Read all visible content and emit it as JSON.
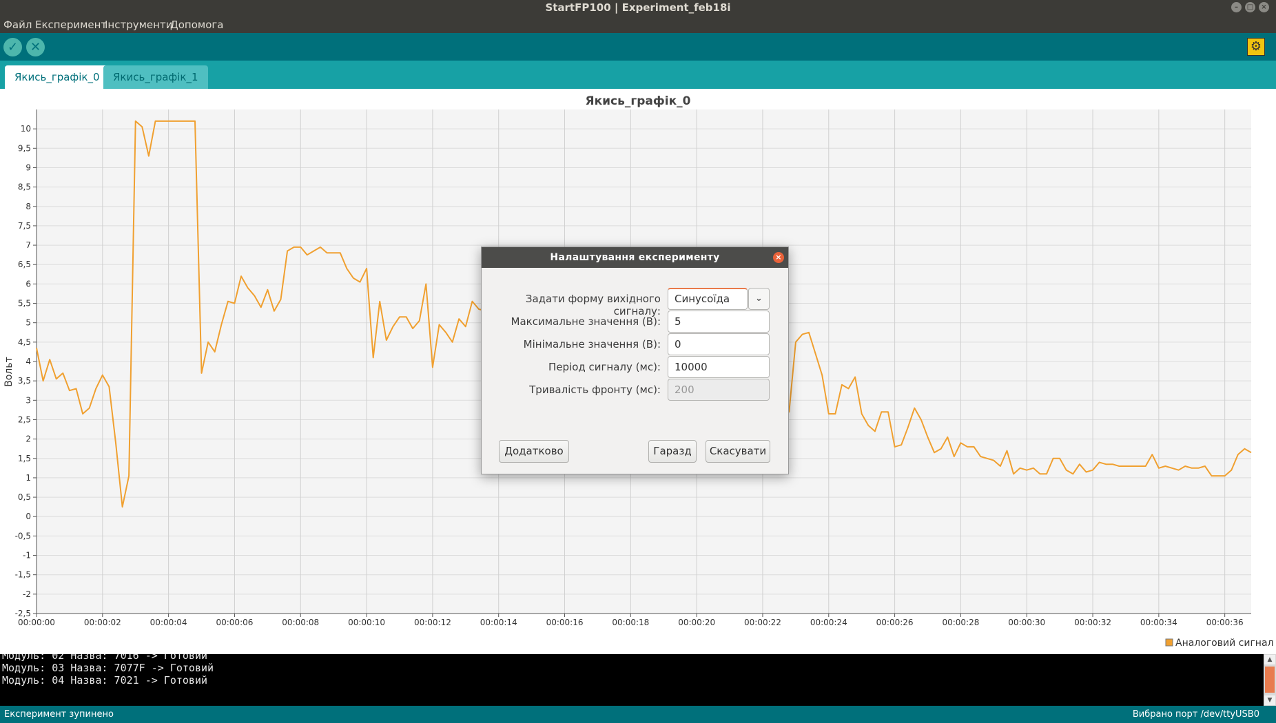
{
  "window": {
    "title": "StartFP100 | Experiment_feb18i"
  },
  "menu": [
    "Файл",
    "Експеримент",
    "Інструменти",
    "Допомога"
  ],
  "toolbar": {
    "verify_icon": "checkmark-icon",
    "stop_icon": "cross-icon",
    "settings_icon": "gear-icon"
  },
  "tabs": [
    {
      "label": "Якись_графік_0",
      "active": true
    },
    {
      "label": "Якись_графік_1",
      "active": false
    }
  ],
  "chart_data": {
    "type": "line",
    "title": "Якись_графік_0",
    "ylabel": "Вольт",
    "xlabel": "",
    "ylim": [
      -2.5,
      10.5
    ],
    "xlim": [
      0,
      36.8
    ],
    "y_ticks": [
      "-2,5",
      "-2",
      "-1,5",
      "-1",
      "-0,5",
      "0",
      "0,5",
      "1",
      "1,5",
      "2",
      "2,5",
      "3",
      "3,5",
      "4",
      "4,5",
      "5",
      "5,5",
      "6",
      "6,5",
      "7",
      "7,5",
      "8",
      "8,5",
      "9",
      "9,5",
      "10"
    ],
    "x_ticks": [
      "00:00:00",
      "00:00:02",
      "00:00:04",
      "00:00:06",
      "00:00:08",
      "00:00:10",
      "00:00:12",
      "00:00:14",
      "00:00:16",
      "00:00:18",
      "00:00:20",
      "00:00:22",
      "00:00:24",
      "00:00:26",
      "00:00:28",
      "00:00:30",
      "00:00:32",
      "00:00:34",
      "00:00:36"
    ],
    "grid": true,
    "legend_position": "bottom-right",
    "series": [
      {
        "name": "Аналоговий сигнал",
        "color": "#f0a030",
        "x": [
          0,
          0.2,
          0.4,
          0.6,
          0.8,
          1.0,
          1.2,
          1.4,
          1.6,
          1.8,
          2.0,
          2.2,
          2.4,
          2.6,
          2.8,
          3.0,
          3.2,
          3.4,
          3.6,
          3.8,
          4.0,
          4.2,
          4.4,
          4.6,
          4.8,
          5.0,
          5.2,
          5.4,
          5.6,
          5.8,
          6.0,
          6.2,
          6.4,
          6.6,
          6.8,
          7.0,
          7.2,
          7.4,
          7.6,
          7.8,
          8.0,
          8.2,
          8.4,
          8.6,
          8.8,
          9.0,
          9.2,
          9.4,
          9.6,
          9.8,
          10.0,
          10.2,
          10.4,
          10.6,
          10.8,
          11.0,
          11.2,
          11.4,
          11.6,
          11.8,
          12.0,
          12.2,
          12.4,
          12.6,
          12.8,
          13.0,
          13.2,
          13.4,
          22.6,
          22.8,
          23.0,
          23.2,
          23.4,
          23.6,
          23.8,
          24.0,
          24.2,
          24.4,
          24.6,
          24.8,
          25.0,
          25.2,
          25.4,
          25.6,
          25.8,
          26.0,
          26.2,
          26.4,
          26.6,
          26.8,
          27.0,
          27.2,
          27.4,
          27.6,
          27.8,
          28.0,
          28.2,
          28.4,
          28.6,
          28.8,
          29.0,
          29.2,
          29.4,
          29.6,
          29.8,
          30.0,
          30.2,
          30.4,
          30.6,
          30.8,
          31.0,
          31.2,
          31.4,
          31.6,
          31.8,
          32.0,
          32.2,
          32.4,
          32.6,
          32.8,
          33.0,
          33.2,
          33.4,
          33.6,
          33.8,
          34.0,
          34.2,
          34.4,
          34.6,
          34.8,
          35.0,
          35.2,
          35.4,
          35.6,
          35.8,
          36.0,
          36.2,
          36.4,
          36.6,
          36.8
        ],
        "y": [
          4.35,
          3.5,
          4.05,
          3.55,
          3.7,
          3.25,
          3.3,
          2.65,
          2.8,
          3.3,
          3.65,
          3.35,
          1.9,
          0.25,
          1.05,
          10.2,
          10.05,
          9.3,
          10.2,
          10.2,
          10.2,
          10.2,
          10.2,
          10.2,
          10.2,
          3.7,
          4.5,
          4.25,
          4.95,
          5.55,
          5.5,
          6.2,
          5.9,
          5.7,
          5.4,
          5.85,
          5.3,
          5.6,
          6.85,
          6.95,
          6.95,
          6.75,
          6.85,
          6.95,
          6.8,
          6.8,
          6.8,
          6.4,
          6.15,
          6.05,
          6.4,
          4.1,
          5.55,
          4.55,
          4.9,
          5.15,
          5.15,
          4.85,
          5.05,
          6.0,
          3.85,
          4.95,
          4.75,
          4.5,
          5.1,
          4.9,
          5.55,
          5.35,
          3.4,
          2.7,
          4.5,
          4.7,
          4.75,
          4.2,
          3.65,
          2.65,
          2.65,
          3.4,
          3.3,
          3.6,
          2.65,
          2.35,
          2.2,
          2.7,
          2.7,
          1.8,
          1.85,
          2.3,
          2.8,
          2.5,
          2.05,
          1.65,
          1.75,
          2.05,
          1.55,
          1.9,
          1.8,
          1.8,
          1.55,
          1.5,
          1.45,
          1.3,
          1.7,
          1.1,
          1.25,
          1.2,
          1.25,
          1.1,
          1.1,
          1.5,
          1.5,
          1.2,
          1.1,
          1.35,
          1.15,
          1.2,
          1.4,
          1.35,
          1.35,
          1.3,
          1.3,
          1.3,
          1.3,
          1.3,
          1.6,
          1.25,
          1.3,
          1.25,
          1.2,
          1.3,
          1.25,
          1.25,
          1.3,
          1.05,
          1.05,
          1.05,
          1.2,
          1.6,
          1.75,
          1.65
        ]
      }
    ]
  },
  "console": {
    "lines": [
      "Модуль: 02 Назва: 7016 -> Готовий",
      "Модуль: 03 Назва: 7077F -> Готовий",
      "Модуль: 04 Назва: 7021 -> Готовий"
    ]
  },
  "status": {
    "left": "Експеримент зупинено",
    "right": "Вибрано порт /dev/ttyUSB0"
  },
  "dialog": {
    "title": "Налаштування експерименту",
    "fields": {
      "waveform_label": "Задати форму вихідного сигналу:",
      "waveform_value": "Синусоїда",
      "max_label": "Максимальне значення (В):",
      "max_value": "5",
      "min_label": "Мінімальне значення (В):",
      "min_value": "0",
      "period_label": "Період сигналу (мс):",
      "period_value": "10000",
      "front_label": "Тривалість фронту (мс):",
      "front_value": "200"
    },
    "buttons": {
      "advanced": "Додатково",
      "ok": "Гаразд",
      "cancel": "Скасувати"
    }
  }
}
